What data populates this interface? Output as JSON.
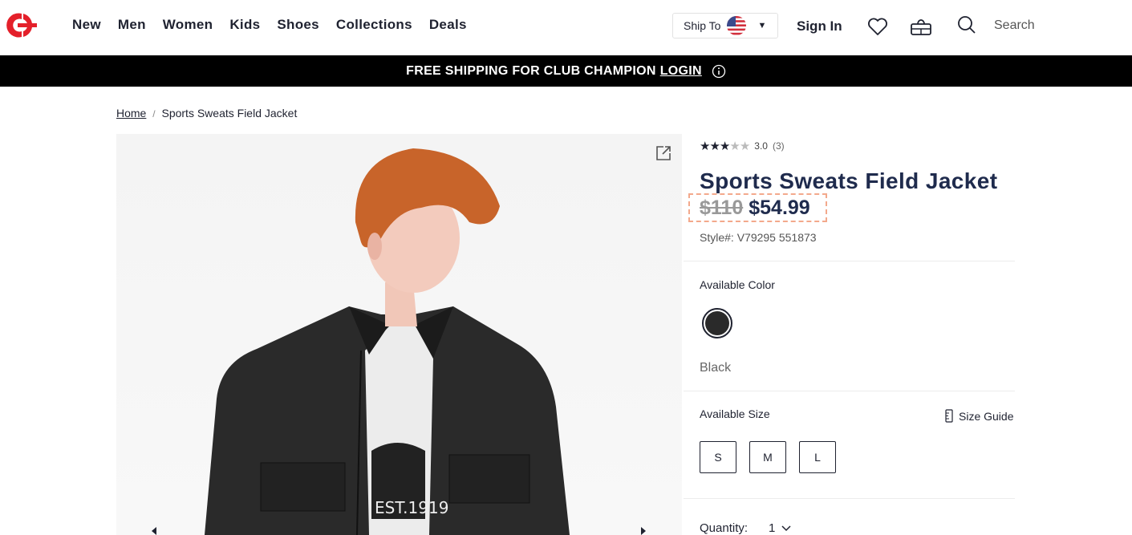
{
  "header": {
    "logo_icon": "champion-c-logo",
    "nav": [
      "New",
      "Men",
      "Women",
      "Kids",
      "Shoes",
      "Collections",
      "Deals"
    ],
    "ship_to_label": "Ship To",
    "ship_to_flag": "us-flag-icon",
    "sign_in_label": "Sign In",
    "wishlist_icon": "heart-icon",
    "cart_icon": "bag-icon",
    "search_icon": "search-icon",
    "search_placeholder": "Search"
  },
  "banner": {
    "text": "FREE SHIPPING FOR CLUB CHAMPION",
    "link": "LOGIN",
    "info_icon": "info-icon"
  },
  "breadcrumb": {
    "home": "Home",
    "separator": "/",
    "current": "Sports Sweats Field Jacket"
  },
  "product": {
    "rating_value": 3,
    "rating_max": 5,
    "rating_score": "3.0",
    "rating_count": "(3)",
    "title": "Sports Sweats Field Jacket",
    "price_old": "$110",
    "price_new": "$54.99",
    "style": "Style#: V79295  551873",
    "color_label": "Available Color",
    "color_name": "Black",
    "color_swatch": "#2a2a2a",
    "size_label": "Available Size",
    "size_guide_label": "Size Guide",
    "sizes": [
      "S",
      "M",
      "L"
    ],
    "quantity_label": "Quantity:",
    "quantity_value": "1"
  },
  "colors": {
    "brand_red": "#e4202a",
    "text_navy": "#1f2b4d",
    "price_highlight_border": "#f3a98c"
  }
}
